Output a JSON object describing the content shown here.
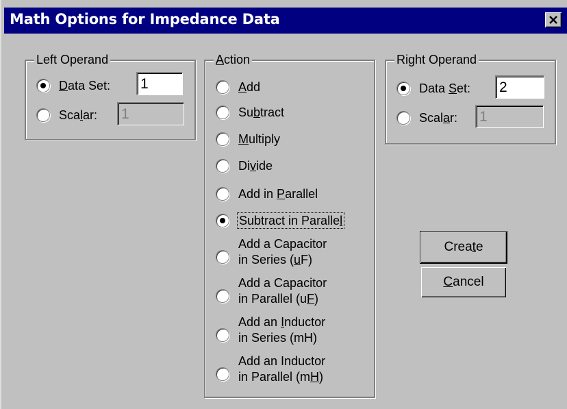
{
  "window": {
    "title": "Math Options for Impedance Data",
    "close_icon": "close-icon"
  },
  "left_operand": {
    "legend": "Left Operand",
    "data_set_label_pre": "",
    "data_set_label_u": "D",
    "data_set_label_post": "ata Set:",
    "data_set_value": "1",
    "data_set_checked": true,
    "scalar_label_pre": "Sca",
    "scalar_label_u": "l",
    "scalar_label_post": "ar:",
    "scalar_value": "1",
    "scalar_checked": false
  },
  "action": {
    "legend_u": "A",
    "legend_post": "ction",
    "options": [
      {
        "pre": "",
        "u": "A",
        "post": "dd",
        "line2_pre": "",
        "line2_u": "",
        "line2_post": "",
        "checked": false
      },
      {
        "pre": "Su",
        "u": "b",
        "post": "tract",
        "line2_pre": "",
        "line2_u": "",
        "line2_post": "",
        "checked": false
      },
      {
        "pre": "",
        "u": "M",
        "post": "ultiply",
        "line2_pre": "",
        "line2_u": "",
        "line2_post": "",
        "checked": false
      },
      {
        "pre": "Di",
        "u": "v",
        "post": "ide",
        "line2_pre": "",
        "line2_u": "",
        "line2_post": "",
        "checked": false
      },
      {
        "pre": "Add in ",
        "u": "P",
        "post": "arallel",
        "line2_pre": "",
        "line2_u": "",
        "line2_post": "",
        "checked": false
      },
      {
        "pre": "Subtract in Paralle",
        "u": "l",
        "post": "",
        "line2_pre": "",
        "line2_u": "",
        "line2_post": "",
        "checked": true
      },
      {
        "pre": "Add a Capacitor",
        "u": "",
        "post": "",
        "line2_pre": "in Series (",
        "line2_u": "u",
        "line2_post": "F)",
        "checked": false
      },
      {
        "pre": "Add a Capacitor",
        "u": "",
        "post": "",
        "line2_pre": "in Parallel (u",
        "line2_u": "F",
        "line2_post": ")",
        "checked": false
      },
      {
        "pre": "Add an ",
        "u": "I",
        "post": "nductor",
        "line2_pre": "in Series (mH)",
        "line2_u": "",
        "line2_post": "",
        "checked": false
      },
      {
        "pre": "Add an Inductor",
        "u": "",
        "post": "",
        "line2_pre": "in Parallel (m",
        "line2_u": "H",
        "line2_post": ")",
        "checked": false
      }
    ]
  },
  "right_operand": {
    "legend": "Right Operand",
    "data_set_label_pre": "Data ",
    "data_set_label_u": "S",
    "data_set_label_post": "et:",
    "data_set_value": "2",
    "data_set_checked": true,
    "scalar_label_pre": "Scal",
    "scalar_label_u": "a",
    "scalar_label_post": "r:",
    "scalar_value": "1",
    "scalar_checked": false
  },
  "buttons": {
    "create_pre": "Crea",
    "create_u": "t",
    "create_post": "e",
    "cancel_pre": "",
    "cancel_u": "C",
    "cancel_post": "ancel"
  }
}
